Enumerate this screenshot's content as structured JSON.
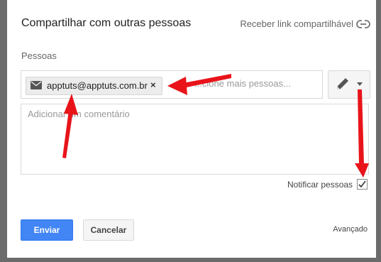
{
  "dialog": {
    "title": "Compartilhar com outras pessoas",
    "share_link_label": "Receber link compartilhável",
    "people_label": "Pessoas",
    "chip": {
      "email": "apptuts@apptuts.com.br",
      "remove_symbol": "×"
    },
    "people_input_placeholder": "...cione mais pessoas...",
    "comment_placeholder": "Adicionar um comentário",
    "notify_label": "Notificar pessoas",
    "notify_checked": true,
    "send_label": "Enviar",
    "cancel_label": "Cancelar",
    "advanced_label": "Avançado"
  },
  "icons": {
    "link": "link-icon",
    "mail": "mail-icon",
    "pencil": "pencil-icon",
    "caret": "caret-down-icon",
    "check": "check-icon"
  },
  "colors": {
    "primary_button": "#4285f4",
    "annotation_arrow": "#e8141a"
  }
}
